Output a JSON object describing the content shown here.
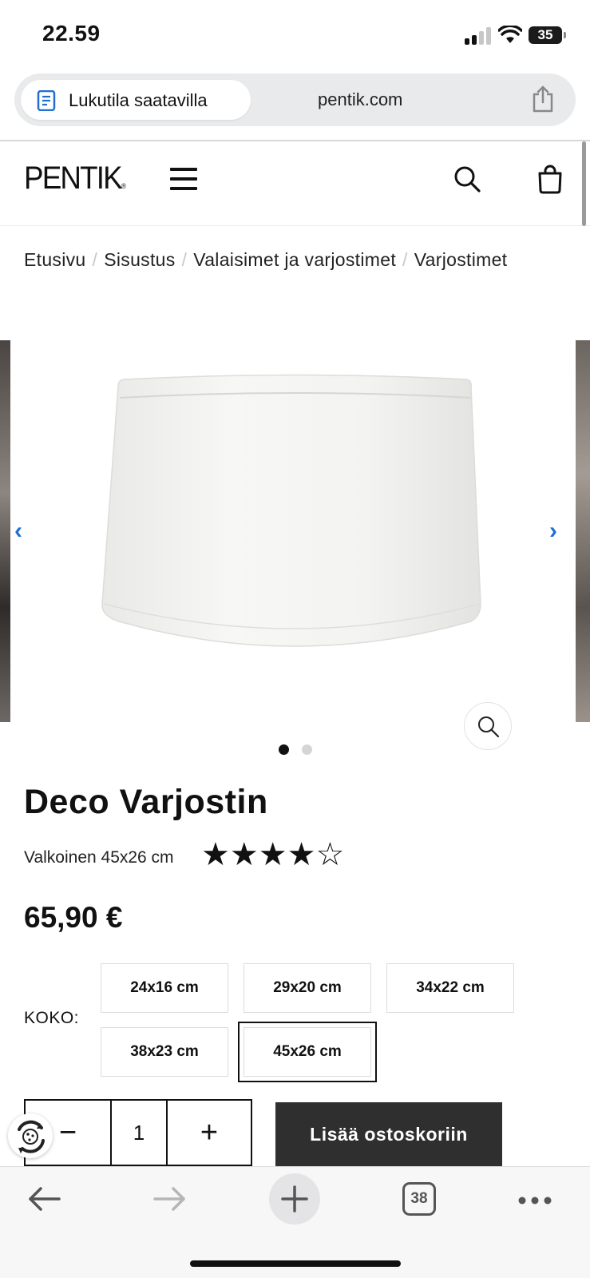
{
  "status_bar": {
    "time": "22.59",
    "battery": "35"
  },
  "browser": {
    "reader_label": "Lukutila saatavilla",
    "url": "pentik.com",
    "open_tabs": "38"
  },
  "site": {
    "logo": "PENTIK",
    "logo_mark": "®"
  },
  "breadcrumb": [
    "Etusivu",
    "Sisustus",
    "Valaisimet ja varjostimet",
    "Varjostimet"
  ],
  "breadcrumb_separator": "/",
  "gallery": {
    "image_count": 2,
    "active_index": 0,
    "prev_glyph": "‹",
    "next_glyph": "›"
  },
  "product": {
    "name": "Deco Varjostin",
    "variant": "Valkoinen 45x26 cm",
    "rating": 4,
    "rating_max": 5,
    "price": "65,90 €"
  },
  "size_label": "KOKO:",
  "sizes": [
    "24x16 cm",
    "29x20 cm",
    "34x22 cm",
    "38x23 cm",
    "45x26 cm"
  ],
  "selected_size": "45x26 cm",
  "quantity": {
    "minus": "−",
    "value": "1",
    "plus": "+"
  },
  "add_to_cart": "Lisää ostoskoriin",
  "colors": {
    "accent": "#1f6fd1",
    "button": "#2f2f2f"
  }
}
